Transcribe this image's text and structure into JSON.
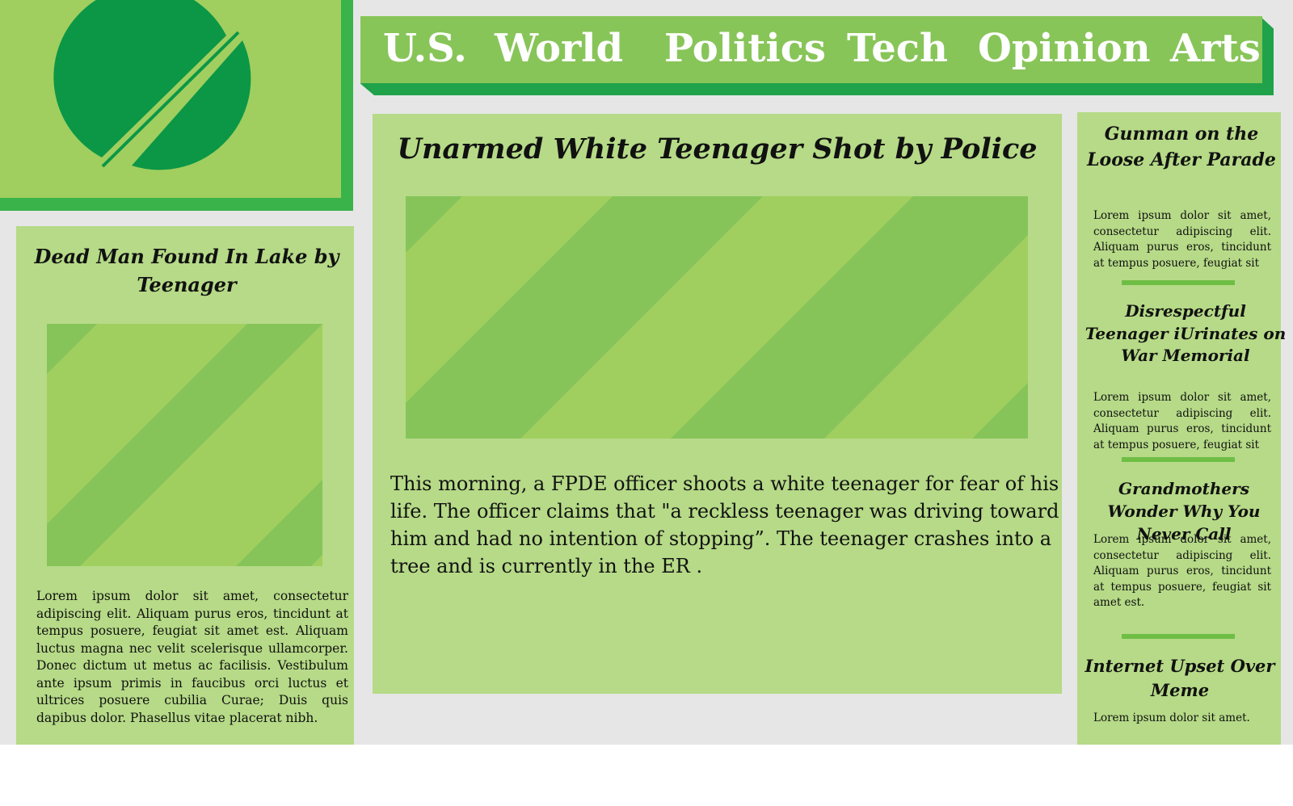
{
  "nav": {
    "items": [
      "U.S.",
      "World",
      "Politics",
      "Tech",
      "Opinion",
      "Arts"
    ]
  },
  "logo": {
    "icon": "split-circle-logo-icon"
  },
  "left_story": {
    "headline": "Dead Man Found In Lake by Teenager",
    "body": "Lorem ipsum dolor sit amet, consectetur adipiscing elit. Aliquam purus eros, tincidunt at tempus posuere, feugiat sit amet est. Aliquam luctus magna nec velit scelerisque ullamcorper. Donec dictum ut metus ac facilisis. Vestibulum ante ipsum primis in faucibus orci luctus et ultrices posuere cubilia Curae; Duis quis dapibus dolor. Phasellus vitae placerat nibh."
  },
  "main_story": {
    "headline": "Unarmed White Teenager Shot by Police",
    "body": "This morning, a FPDE officer shoots a white teenager for fear of his life. The officer claims that \"a reckless teenager was driving toward him and had no intention of stopping”. The teenager crashes into a tree and is currently in the ER ."
  },
  "sidebar": {
    "stories": [
      {
        "headline": "Gunman on the Loose After Parade",
        "body": "Lorem ipsum dolor sit amet, consectetur adipiscing elit. Aliquam purus eros, tincidunt at tempus posuere, feugiat sit"
      },
      {
        "headline": "Disrespectful Teenager iUrinates on War Memorial",
        "body": "Lorem ipsum dolor sit amet, consectetur adipiscing elit. Aliquam purus eros, tincidunt at tempus posuere, feugiat sit"
      },
      {
        "headline": "Grandmothers Wonder Why You Never Call",
        "body": "Lorem ipsum dolor sit amet, consectetur adipiscing elit. Aliquam purus eros, tincidunt at tempus posuere, feugiat sit amet est."
      },
      {
        "headline": "Internet Upset Over Meme",
        "body": "Lorem ipsum dolor sit amet."
      }
    ]
  },
  "colors": {
    "background": "#e6e6e6",
    "nav_bar": "#88c559",
    "nav_shadow": "#1fa24a",
    "panel": "#b6da87",
    "logo_box": "#a0cf5f",
    "logo_mark": "#0b9746",
    "stripe_light": "#a0cf5f",
    "stripe_dark": "#86c45a",
    "divider": "#6fbe44"
  }
}
